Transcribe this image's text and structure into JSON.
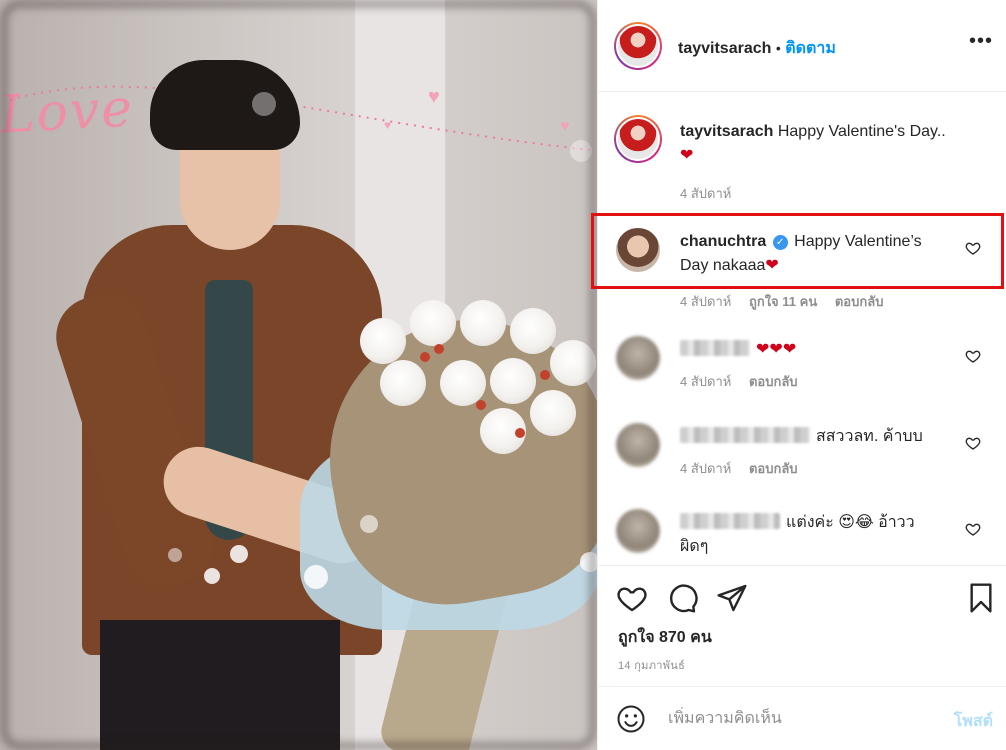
{
  "post": {
    "author": "tayvitsarach",
    "dot": "•",
    "follow_label": "ติดตาม",
    "more_label": "•••"
  },
  "photo": {
    "overlay_text": "Love"
  },
  "caption": {
    "username": "tayvitsarach",
    "text": "Happy Valentine's Day..",
    "emoji": "❤",
    "age": "4 สัปดาห์"
  },
  "comments": [
    {
      "username": "chanuchtra",
      "verified": true,
      "text": "Happy Valentine’s Day nakaaa",
      "emoji": "❤",
      "age": "4 สัปดาห์",
      "likes": "ถูกใจ 11 คน",
      "reply": "ตอบกลับ",
      "highlighted": true
    },
    {
      "username": "",
      "text": "❤❤❤",
      "age": "4 สัปดาห์",
      "reply": "ตอบกลับ"
    },
    {
      "username": "",
      "text": "สสววลท. ค้าบบ",
      "age": "4 สัปดาห์",
      "reply": "ตอบกลับ"
    },
    {
      "username": "",
      "text": "แต่งค่ะ 😍😂 อ้าวว ผิดๆ",
      "age": "",
      "reply": ""
    }
  ],
  "actions": {
    "likes": "ถูกใจ 870 คน",
    "date": "14 กุมภาพันธ์"
  },
  "add_comment": {
    "placeholder": "เพิ่มความคิดเห็น",
    "post_label": "โพสต์"
  },
  "colors": {
    "link_blue": "#0095f6",
    "highlight_red": "#e11111",
    "muted_gray": "#8e8e8e"
  }
}
